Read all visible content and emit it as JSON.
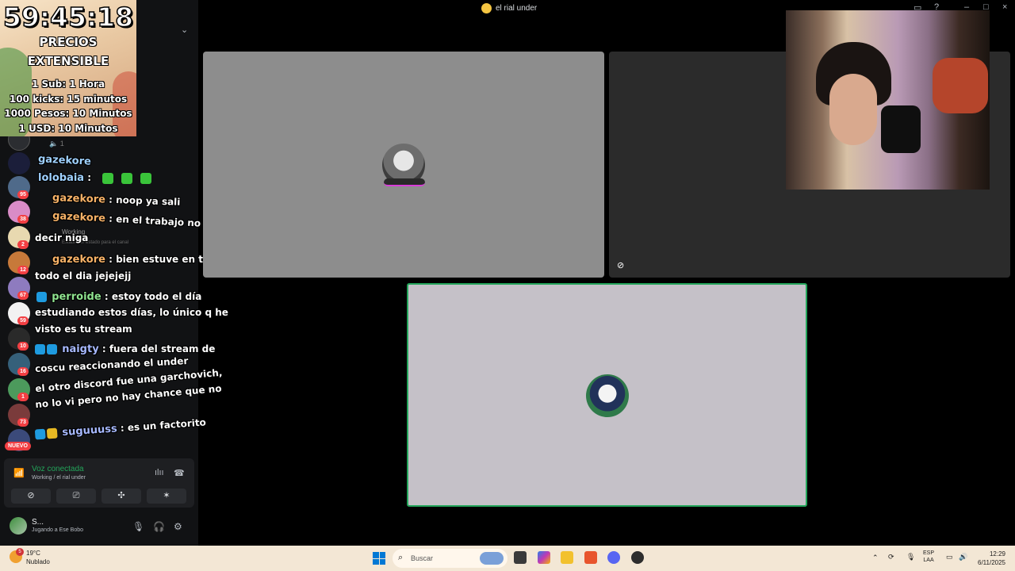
{
  "window": {
    "title": "el rial under"
  },
  "overlay": {
    "timer": "59:45:18",
    "price_lines": [
      "PRECIOS",
      "EXTENSIBLE",
      "1 Sub: 1 Hora",
      "100 kicks: 15 minutos",
      "1000 Pesos: 10 Minutos",
      "1 USD: 10 Minutos"
    ]
  },
  "servers": {
    "badges": [
      "95",
      "38",
      "2",
      "12",
      "67",
      "59",
      "10",
      "16",
      "1",
      "73"
    ],
    "new_label": "NUEVO"
  },
  "chat": {
    "messages": [
      {
        "user": "gazekore",
        "text": ""
      },
      {
        "user": "lolobaia",
        "text": ""
      },
      {
        "user": "gazekore",
        "text": "noop ya sali"
      },
      {
        "user": "gazekore",
        "text": "en el trabajo no puedo",
        "cont": "decir niga"
      },
      {
        "user": "gazekore",
        "text": "bien estuve en tuiter",
        "cont": "todo el dia jejejejj"
      },
      {
        "user": "perroide",
        "text": "estoy todo el día",
        "cont": "estudiando estos días, lo único q he",
        "cont2": "visto es tu stream"
      },
      {
        "user": "naigty",
        "text": "fuera del stream de",
        "cont": "coscu reaccionando el under",
        "cont2": "el otro discord fue una garchovich,",
        "cont3": "no lo vi pero no hay chance que no"
      },
      {
        "user": "suguuuss",
        "text": "es un factorito"
      }
    ],
    "ghost": {
      "channel_user": "Working",
      "status_hint": "Establecer estado para el canal"
    }
  },
  "voice": {
    "status": "Voz conectada",
    "channel": "Working / el rial under"
  },
  "user_panel": {
    "name": "S...",
    "activity": "Jugando a Ese Bobo"
  },
  "taskbar": {
    "weather_temp": "19°C",
    "weather_desc": "Nublado",
    "weather_badge": "5",
    "search_placeholder": "Buscar",
    "lang_1": "ESP",
    "lang_2": "LAA",
    "time": "12:29",
    "date": "6/11/2025"
  },
  "colors": {
    "voice_green": "#23a55a",
    "speaking_border": "#23a55a",
    "mention_red": "#f23f43"
  }
}
